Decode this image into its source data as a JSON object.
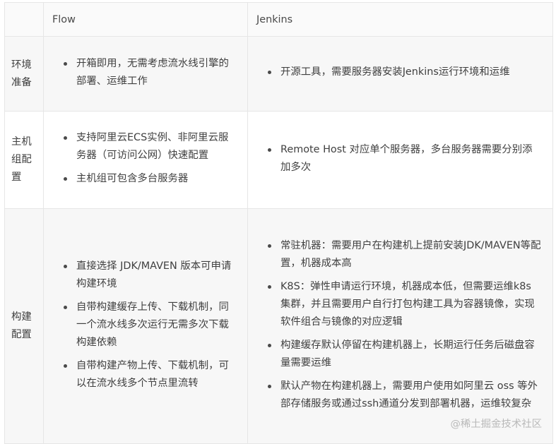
{
  "table": {
    "headers": [
      "",
      "Flow",
      "Jenkins"
    ],
    "rows": [
      {
        "label": "环境准备",
        "flow": [
          "开箱即用，无需考虑流水线引擎的部署、运维工作"
        ],
        "jenkins": [
          "开源工具，需要服务器安装Jenkins运行环境和运维"
        ]
      },
      {
        "label": "主机组配置",
        "flow": [
          "支持阿里云ECS实例、非阿里云服务器（可访问公网）快速配置",
          "主机组可包含多台服务器"
        ],
        "jenkins": [
          "Remote Host 对应单个服务器，多台服务器需要分别添加多次"
        ]
      },
      {
        "label": "构建配置",
        "flow": [
          "直接选择 JDK/MAVEN 版本可申请构建环境",
          "自带构建缓存上传、下载机制，同一个流水线多次运行无需多次下载构建依赖",
          "自带构建产物上传、下载机制，可以在流水线多个节点里流转"
        ],
        "jenkins": [
          "常驻机器：需要用户在构建机上提前安装JDK/MAVEN等配置，机器成本高",
          "K8S：弹性申请运行环境，机器成本低，但需要运维k8s集群，并且需要用户自行打包构建工具为容器镜像，实现软件组合与镜像的对应逻辑",
          "构建缓存默认停留在构建机器上，长期运行任务后磁盘容量需要运维",
          "默认产物在构建机器上，需要用户使用如阿里云 oss 等外部存储服务或通过ssh通道分发到部署机器，运维较复杂"
        ]
      }
    ]
  },
  "watermark": "@稀土掘金技术社区"
}
